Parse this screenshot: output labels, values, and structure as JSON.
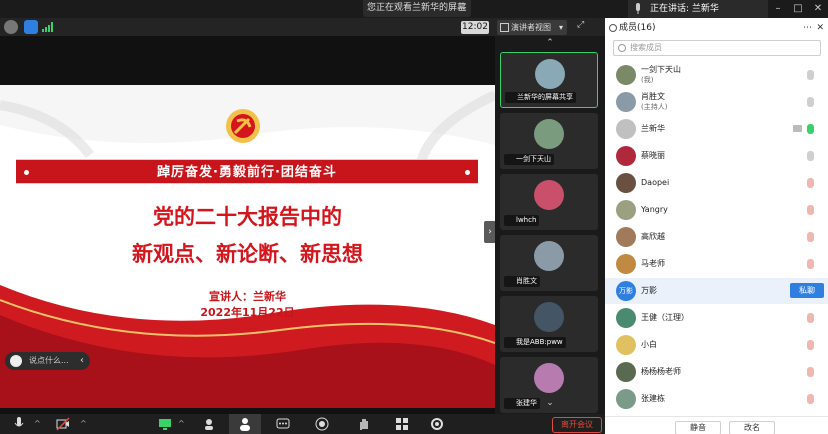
{
  "topbar": {
    "viewing_text": "您正在观看兰新华的屏幕",
    "speaking_text": "正在讲话: 兰新华",
    "window_buttons": [
      "minimize-icon",
      "maximize-icon",
      "close-icon"
    ]
  },
  "toolbar": {
    "time": "12:02",
    "view_label": "演讲者视图"
  },
  "slide": {
    "banner": "踔厉奋发·勇毅前行·团结奋斗",
    "title_line1": "党的二十大报告中的",
    "title_line2": "新观点、新论断、新思想",
    "speaker": "宣讲人：兰新华",
    "date": "2022年11月22日"
  },
  "comment": {
    "placeholder": "说点什么..."
  },
  "gallery": [
    {
      "label": "兰新华的屏幕共享",
      "avatar_color": "#8aa9b6",
      "active": true
    },
    {
      "label": "一剑下天山",
      "avatar_color": "#7a9b7e",
      "active": false
    },
    {
      "label": "lwhch",
      "avatar_color": "#c94f6a",
      "active": false
    },
    {
      "label": "肖胜文",
      "avatar_color": "#8a9aa6",
      "active": false
    },
    {
      "label": "我是ABB:pww",
      "avatar_color": "#445566",
      "active": false
    },
    {
      "label": "张建华",
      "avatar_color": "#b77bb0",
      "active": false
    }
  ],
  "bottom": {
    "end_label": "离开会议"
  },
  "panel": {
    "title": "成员(16)",
    "search_placeholder": "搜索成员",
    "members": [
      {
        "name": "一剑下天山",
        "sub": "(我)",
        "avatar_color": "#7a8a66",
        "mic": "idle"
      },
      {
        "name": "肖胜文",
        "sub": "(主持人)",
        "avatar_color": "#8a9aa6",
        "mic": "idle"
      },
      {
        "name": "兰新华",
        "sub": "",
        "avatar_color": "#c0c0c0",
        "mic": "on"
      },
      {
        "name": "蔡晓丽",
        "sub": "",
        "avatar_color": "#b0283c",
        "mic": "idle"
      },
      {
        "name": "Daopei",
        "sub": "",
        "avatar_color": "#6a5040",
        "mic": "muted"
      },
      {
        "name": "Yangry",
        "sub": "",
        "avatar_color": "#9aa080",
        "mic": "muted"
      },
      {
        "name": "高欣越",
        "sub": "",
        "avatar_color": "#a07a5a",
        "mic": "muted"
      },
      {
        "name": "马老师",
        "sub": "",
        "avatar_color": "#c08a40",
        "mic": "muted"
      },
      {
        "name": "万影",
        "sub": "",
        "avatar_color": "#2f7fe0",
        "mic": "none",
        "highlight": true,
        "action": "私聊",
        "initials": "万影"
      },
      {
        "name": "王健（江理）",
        "sub": "",
        "avatar_color": "#4a8a70",
        "mic": "muted"
      },
      {
        "name": "小白",
        "sub": "",
        "avatar_color": "#e0c060",
        "mic": "muted"
      },
      {
        "name": "杨杨杨老师",
        "sub": "",
        "avatar_color": "#5a6a50",
        "mic": "muted"
      },
      {
        "name": "张建栋",
        "sub": "",
        "avatar_color": "#7a9a8a",
        "mic": "muted"
      }
    ],
    "footer": {
      "mute_all": "静音",
      "rename": "改名"
    }
  },
  "colors": {
    "accent": "#3ad16b",
    "brand_red": "#d4151c",
    "panel_blue": "#2f7fe0"
  }
}
